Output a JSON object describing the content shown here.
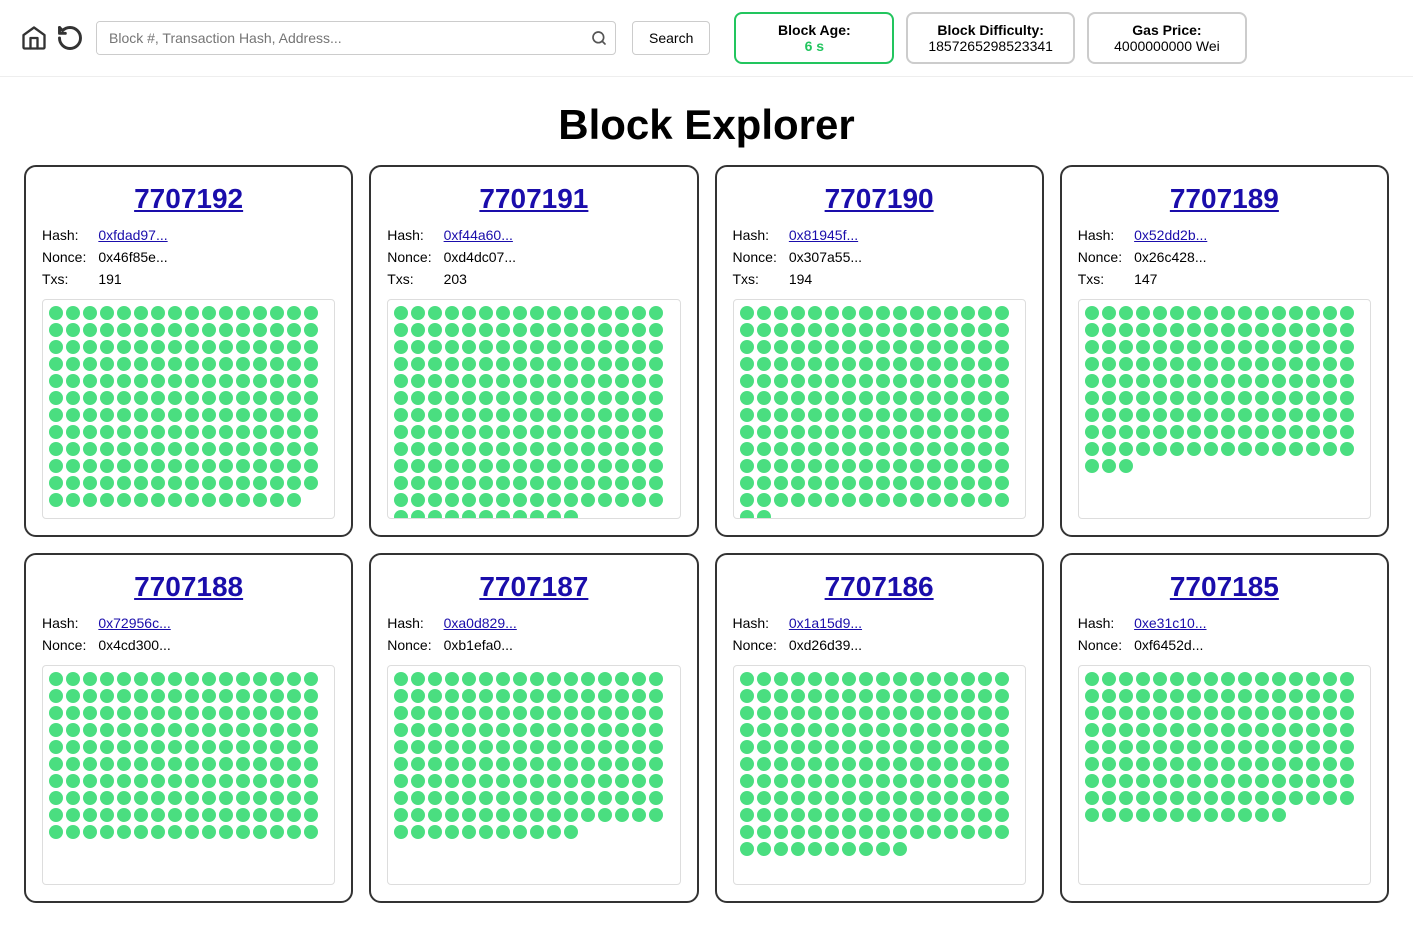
{
  "header": {
    "search_placeholder": "Block #, Transaction Hash, Address...",
    "search_label": "Search",
    "stats": [
      {
        "id": "block-age",
        "label": "Block Age:",
        "value": "6 s",
        "green": true
      },
      {
        "id": "block-difficulty",
        "label": "Block Difficulty:",
        "value": "1857265298523341",
        "green": false
      },
      {
        "id": "gas-price",
        "label": "Gas Price:",
        "value": "4000000000 Wei",
        "green": false
      }
    ]
  },
  "page_title": "Block Explorer",
  "blocks": [
    {
      "number": "7707192",
      "hash": "0xfdad97...",
      "nonce": "0x46f85e...",
      "txs": "191",
      "dots": 191
    },
    {
      "number": "7707191",
      "hash": "0xf44a60...",
      "nonce": "0xd4dc07...",
      "txs": "203",
      "dots": 203
    },
    {
      "number": "7707190",
      "hash": "0x81945f...",
      "nonce": "0x307a55...",
      "txs": "194",
      "dots": 194
    },
    {
      "number": "7707189",
      "hash": "0x52dd2b...",
      "nonce": "0x26c428...",
      "txs": "147",
      "dots": 147
    },
    {
      "number": "7707188",
      "hash": "0x72956c...",
      "nonce": "0x4cd300...",
      "txs": "",
      "dots": 160
    },
    {
      "number": "7707187",
      "hash": "0xa0d829...",
      "nonce": "0xb1efa0...",
      "txs": "",
      "dots": 155
    },
    {
      "number": "7707186",
      "hash": "0x1a15d9...",
      "nonce": "0xd26d39...",
      "txs": "",
      "dots": 170
    },
    {
      "number": "7707185",
      "hash": "0xe31c10...",
      "nonce": "0xf6452d...",
      "txs": "",
      "dots": 140
    }
  ]
}
